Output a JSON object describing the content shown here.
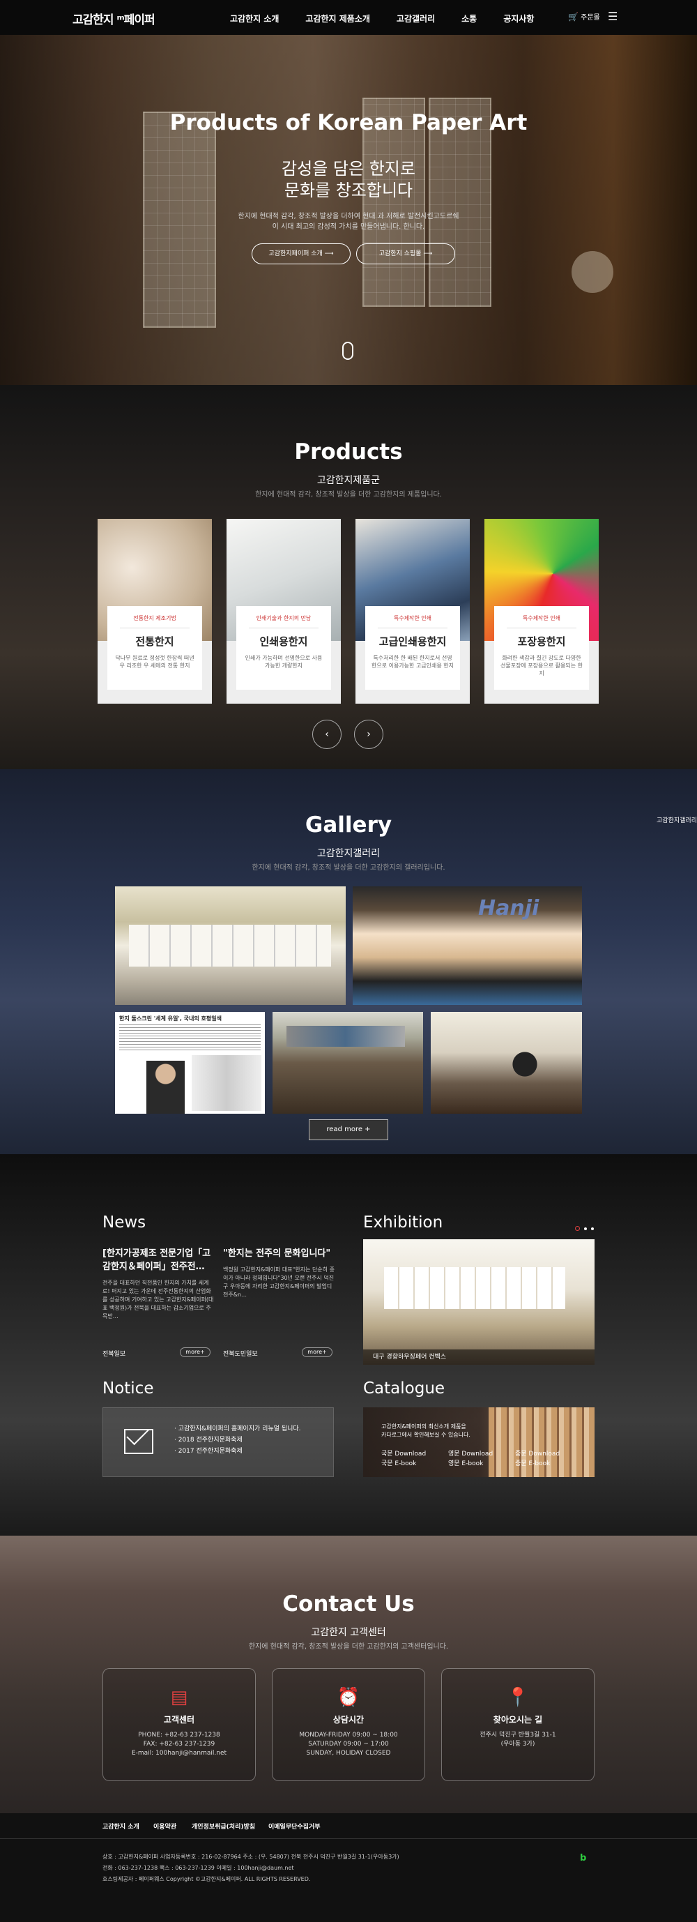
{
  "header": {
    "logo": "고감한지 ᵐ페이퍼",
    "nav": [
      "고감한지 소개",
      "고감한지 제품소개",
      "고감갤러리",
      "소통",
      "공지사항"
    ],
    "cart": "주문몰"
  },
  "hero": {
    "title": "Products of Korean Paper Art",
    "sub1": "감성을 담은 한지로",
    "sub2": "문화를 창조합니다",
    "desc1": "한지에 현대적 감각, 창조적 발상을 더하여 현대 과 저해로 발전시킨고도르쉐",
    "desc2": "이 시대 최고의 감성적 가치를 만들어냅니다. 한니다.",
    "btn1": "고감한지페이퍼 소개 ⟶",
    "btn2": "고감한지 쇼핑몰 ⟶"
  },
  "products": {
    "title": "Products",
    "sub": "고감한지제품군",
    "desc": "한지에 현대적 감각, 창조적 발상을 더한 고감한지의 제품입니다.",
    "items": [
      {
        "tag": "전통한지 제조기법",
        "name": "전통한지",
        "desc": "닥나무 원료로 정성껏 한장씩 떠낸 우 리조한 우 세에의 전통 한지"
      },
      {
        "tag": "인쇄기술과 한지의 만남",
        "name": "인쇄용한지",
        "desc": "인쇄가 가능하며 선명한으로 사용 가능한 개량한지"
      },
      {
        "tag": "특수제작한 인쇄",
        "name": "고급인쇄용한지",
        "desc": "특수처리한 한 배된 한지로서 선명한으로 이용가능한 고급인쇄용 한지"
      },
      {
        "tag": "특수제작한 인쇄",
        "name": "포장용한지",
        "desc": "화려한 색감과 질긴 강도로 다양한 선물포장에 포장용으로 활용되는 한지"
      }
    ]
  },
  "gallery": {
    "title": "Gallery",
    "sub": "고감한지갤러리",
    "desc": "한지에 현대적 감각, 창조적 발상을 더한 고감한지의 갤러리입니다.",
    "side": "고감한지갤러리",
    "readmore": "read more +",
    "banner": "Hanji",
    "article": "한지 둘스크린 '세계 유일', 국내외 호평일색"
  },
  "news": {
    "title": "News",
    "items": [
      {
        "title": "[한지가공제조 전문기업「고감한지＆페이퍼」전주전…",
        "desc": "전주을 대표하던 직전품인 한지의 가치를 세계로! 퍼지고 있는 가운데 전주전통한지의 산업화를 성공하며 기여하고 있는 고감한지&페이퍼(대표 백정원)가 전북을 대표하는 갑소기업으로 주목받…",
        "source": "전북일보",
        "more": "more+"
      },
      {
        "title": "\"한지는 전주의 문화입니다\"",
        "desc": "백정원 고감한지&페이퍼 대표\"한지는 단순히 종이가 아니라 정체입니다\"30년 오랜 전주시 덕진구 우아동에 자리한 고감한지&페이퍼의 발업디 전주&n…",
        "source": "전북도민일보",
        "more": "more+"
      }
    ]
  },
  "exhibition": {
    "title": "Exhibition",
    "caption": "대구 경향하우징페어 컨벡스"
  },
  "notice": {
    "title": "Notice",
    "items": [
      "고감한지&페이퍼의 홈페이지가 리뉴얼 됩니다.",
      "2018 전주한지문화축제",
      "2017 전주한지문화축제"
    ]
  },
  "catalogue": {
    "title": "Catalogue",
    "desc1": "고감한지&페이퍼의 최신소개 제품을",
    "desc2": "카다로그에서 확인해보실 수 있습니다.",
    "links": [
      [
        "국문 Download",
        "국문 E-book"
      ],
      [
        "영문 Download",
        "영문 E-book"
      ],
      [
        "중문 Download",
        "중문 E-book"
      ]
    ]
  },
  "contact": {
    "title": "Contact Us",
    "sub": "고감한지 고객센터",
    "desc": "한지에 현대적 감각, 창조적 발상을 더한 고감한지의 고객센터입니다.",
    "boxes": [
      {
        "title": "고객센터",
        "lines": [
          "PHONE: +82-63 237-1238",
          "FAX: +82-63 237-1239",
          "E-mail: 100hanji@hanmail.net"
        ]
      },
      {
        "title": "상담시간",
        "lines": [
          "MONDAY-FRIDAY 09:00 ~ 18:00",
          "SATURDAY 09:00 ~ 17:00",
          "SUNDAY, HOLIDAY CLOSED"
        ]
      },
      {
        "title": "찾아오시는 길",
        "lines": [
          "전주시 덕진구 반월3길 31-1",
          "(우아동 3가)"
        ]
      }
    ]
  },
  "footer": {
    "menu": [
      "고감한지 소개",
      "이용약관",
      "개인정보취급(처리)방침",
      "이메일무단수집거부"
    ],
    "line1": "상호 : 고감한지&페이퍼    사업자등록번호 : 216-02-87964    주소 : (우. 54807) 전북 전주시 덕진구 반월3길 31-1(우아동3가)",
    "line2": "전화 : 063-237-1238    팩스 : 063-237-1239    이메일 : 100hanji@daum.net",
    "line3": "호스팅제공자 : 페이퍼웨스    Copyright ©고감한지&페이퍼. ALL RIGHTS RESERVED."
  },
  "colors": {
    "accent": "#e04040",
    "dark": "#111111"
  }
}
